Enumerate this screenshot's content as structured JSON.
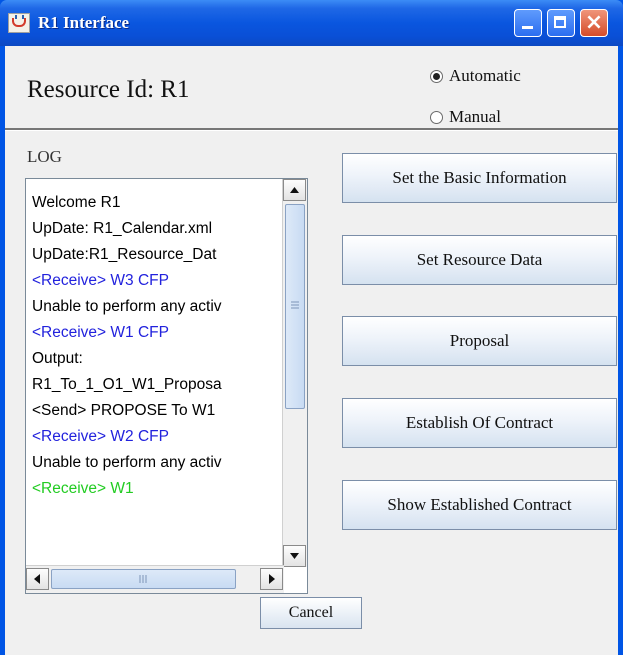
{
  "window": {
    "title": "R1 Interface"
  },
  "header": {
    "resource_id": "Resource Id:  R1"
  },
  "mode": {
    "automatic": "Automatic",
    "manual": "Manual",
    "selected": "Automatic"
  },
  "log": {
    "label": "LOG",
    "lines": [
      {
        "text": "Welcome R1",
        "color": "#000000"
      },
      {
        "text": "UpDate: R1_Calendar.xml",
        "color": "#000000"
      },
      {
        "text": "UpDate:R1_Resource_Dat",
        "color": "#000000"
      },
      {
        "text": "<Receive> W3 CFP",
        "color": "#2222dd"
      },
      {
        "text": "Unable to perform any activ",
        "color": "#000000"
      },
      {
        "text": "<Receive> W1 CFP",
        "color": "#2222dd"
      },
      {
        "text": "Output:",
        "color": "#000000"
      },
      {
        "text": "R1_To_1_O1_W1_Proposa",
        "color": "#000000"
      },
      {
        "text": "<Send> PROPOSE To W1",
        "color": "#000000"
      },
      {
        "text": "<Receive> W2 CFP",
        "color": "#2222dd"
      },
      {
        "text": "Unable to perform any activ",
        "color": "#000000"
      },
      {
        "text": "<Receive> W1",
        "color": "#22cc22"
      }
    ]
  },
  "buttons": {
    "basic_info": "Set the Basic Information",
    "resource_data": "Set Resource Data",
    "proposal": "Proposal",
    "establish": "Establish Of Contract",
    "show_contract": "Show Established Contract",
    "cancel": "Cancel"
  }
}
